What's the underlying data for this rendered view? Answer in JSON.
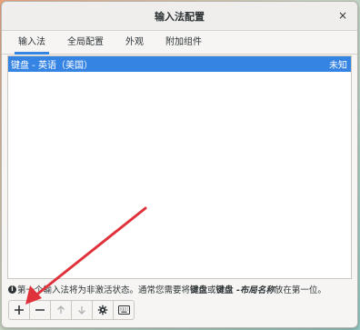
{
  "window": {
    "title": "输入法配置",
    "close_glyph": "×"
  },
  "tabs": [
    {
      "label": "输入法",
      "active": true
    },
    {
      "label": "全局配置",
      "active": false
    },
    {
      "label": "外观",
      "active": false
    },
    {
      "label": "附加组件",
      "active": false
    }
  ],
  "input_methods": [
    {
      "name": "键盘 - 英语（美国）",
      "status": "未知",
      "selected": true
    }
  ],
  "note": {
    "prefix": "第一个输入法将为非激活状态。通常您需要将",
    "bold1": "键盘",
    "or": "或",
    "bold2": "键盘 - ",
    "italic": "布局名称",
    "suffix": "放在第一位。"
  },
  "toolbar": {
    "buttons": [
      {
        "icon": "plus-icon",
        "enabled": true
      },
      {
        "icon": "minus-icon",
        "enabled": true
      },
      {
        "icon": "arrow-up-icon",
        "enabled": false
      },
      {
        "icon": "arrow-down-icon",
        "enabled": false
      },
      {
        "icon": "gear-icon",
        "enabled": true
      },
      {
        "icon": "keyboard-icon",
        "enabled": true
      }
    ]
  },
  "annotation": {
    "arrow_color": "#e0323b"
  }
}
